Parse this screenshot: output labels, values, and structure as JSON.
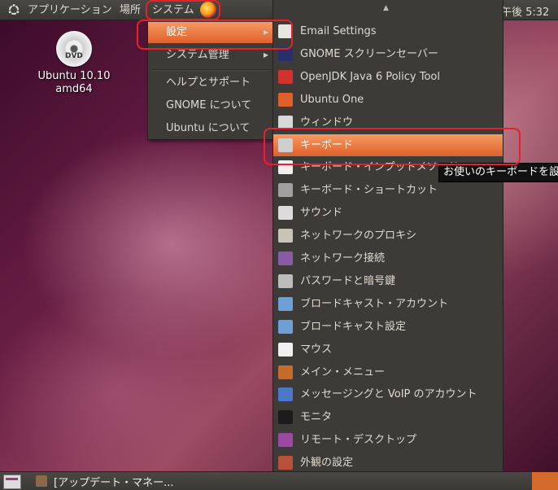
{
  "top_panel": {
    "applications": "アプリケーション",
    "places": "場所",
    "system": "システム",
    "clock": "午後 5:32"
  },
  "desktop": {
    "dvd_badge": "DVD",
    "dvd_label_line1": "Ubuntu 10.10",
    "dvd_label_line2": "amd64"
  },
  "system_menu": {
    "items": [
      {
        "label": "設定",
        "has_submenu": true,
        "active": true
      },
      {
        "label": "システム管理",
        "has_submenu": true
      },
      {
        "label": "ヘルプとサポート"
      },
      {
        "label": "GNOME について"
      },
      {
        "label": "Ubuntu について"
      }
    ]
  },
  "settings_menu": {
    "items": [
      {
        "label": "Email Settings",
        "icon": "email-settings-icon",
        "color": "#e8e6e0"
      },
      {
        "label": "GNOME スクリーンセーバー",
        "icon": "screensaver-icon",
        "color": "#27306a"
      },
      {
        "label": "OpenJDK Java 6 Policy Tool",
        "icon": "java-icon",
        "color": "#d2322d"
      },
      {
        "label": "Ubuntu One",
        "icon": "ubuntu-one-icon",
        "color": "#e0602b"
      },
      {
        "label": "ウィンドウ",
        "icon": "window-icon",
        "color": "#d8d8d8"
      },
      {
        "label": "キーボード",
        "icon": "keyboard-icon",
        "color": "#cfcfcf",
        "active": true
      },
      {
        "label": "キーボード・インプットメソッド",
        "icon": "input-method-icon",
        "color": "#efefef"
      },
      {
        "label": "キーボード・ショートカット",
        "icon": "keyboard-shortcut-icon",
        "color": "#a0a0a0"
      },
      {
        "label": "サウンド",
        "icon": "sound-icon",
        "color": "#dcdcdc"
      },
      {
        "label": "ネットワークのプロキシ",
        "icon": "network-proxy-icon",
        "color": "#c9c4b8"
      },
      {
        "label": "ネットワーク接続",
        "icon": "network-connections-icon",
        "color": "#8a5aa6"
      },
      {
        "label": "パスワードと暗号鍵",
        "icon": "passwords-keys-icon",
        "color": "#bcbcbc"
      },
      {
        "label": "ブロードキャスト・アカウント",
        "icon": "broadcast-account-icon",
        "color": "#6e9fd6"
      },
      {
        "label": "ブロードキャスト設定",
        "icon": "broadcast-settings-icon",
        "color": "#6e9fd6"
      },
      {
        "label": "マウス",
        "icon": "mouse-icon",
        "color": "#f0f0f0"
      },
      {
        "label": "メイン・メニュー",
        "icon": "main-menu-icon",
        "color": "#c66b2a"
      },
      {
        "label": "メッセージングと VoIP のアカウント",
        "icon": "messaging-voip-icon",
        "color": "#4d78c8"
      },
      {
        "label": "モニタ",
        "icon": "monitor-icon",
        "color": "#1c1c1c"
      },
      {
        "label": "リモート・デスクトップ",
        "icon": "remote-desktop-icon",
        "color": "#9a4aa0"
      },
      {
        "label": "外観の設定",
        "icon": "appearance-icon",
        "color": "#b8503a"
      }
    ]
  },
  "tooltip": "お使いのキーボードを設",
  "bottom_panel": {
    "task_label": "[アップデート・マネー..."
  }
}
